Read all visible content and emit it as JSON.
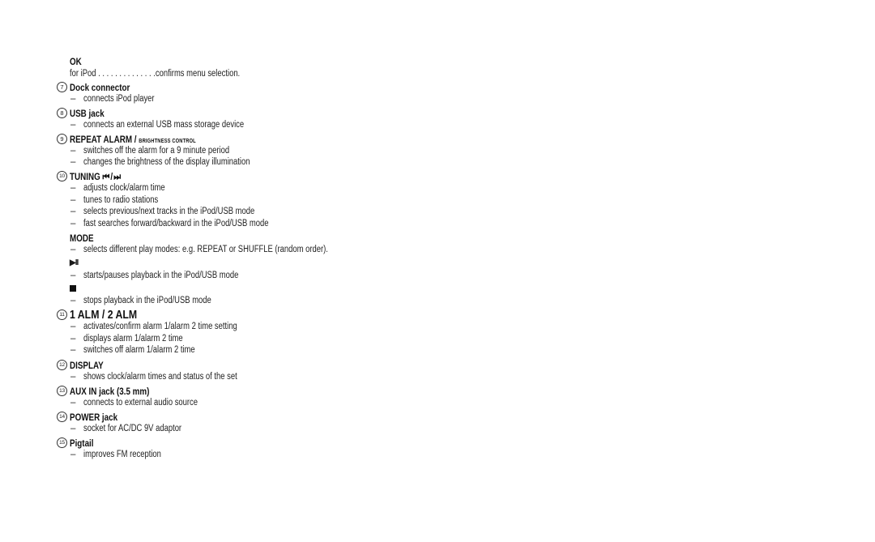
{
  "sections": {
    "ok": {
      "title": "OK",
      "row_label": "for iPod",
      "leader": ". . . . . . . . . . . . . .",
      "row_value": "confirms menu selection."
    },
    "dock": {
      "number": "7",
      "title": "Dock connector",
      "items": [
        "connects iPod player"
      ]
    },
    "usb": {
      "number": "8",
      "title": "USB jack",
      "items": [
        "connects an external USB mass storage device"
      ]
    },
    "repeat": {
      "number": "9",
      "title": "REPEAT ALARM /",
      "subtitle": "BRIGHTNESS CONTROL",
      "items": [
        "switches off the alarm for a 9 minute period",
        "changes the brightness of the display illumination"
      ]
    },
    "tuning": {
      "number": "10",
      "title": "TUNING",
      "symbols": "⏮ / ⏭",
      "items": [
        "adjusts clock/alarm time",
        "tunes to radio stations",
        "selects previous/next tracks in the iPod/USB mode",
        "fast searches forward/backward in the iPod/USB mode"
      ]
    },
    "mode": {
      "title": "MODE",
      "items": [
        "selects different play modes: e.g. REPEAT or SHUFFLE (random order)."
      ]
    },
    "playpause": {
      "symbol": "▶II",
      "items": [
        "starts/pauses playback in the iPod/USB mode"
      ]
    },
    "stop": {
      "symbol": "■",
      "items": [
        "stops playback in the iPod/USB mode"
      ]
    },
    "alarm": {
      "number": "11",
      "title": "1 ALM / 2 ALM",
      "items": [
        "activates/confirm alarm 1/alarm 2 time setting",
        "displays alarm 1/alarm 2 time",
        "switches off alarm 1/alarm 2 time"
      ]
    },
    "display": {
      "number": "12",
      "title": "DISPLAY",
      "items": [
        "shows clock/alarm times and status of the set"
      ]
    },
    "aux": {
      "number": "13",
      "title": "AUX IN jack (3.5 mm)",
      "items": [
        "connects to external audio source"
      ]
    },
    "power": {
      "number": "14",
      "title": "POWER jack",
      "items": [
        "socket for AC/DC 9V adaptor"
      ]
    },
    "pigtail": {
      "number": "15",
      "title": "Pigtail",
      "items": [
        "improves FM reception"
      ]
    }
  },
  "bullet": "–"
}
